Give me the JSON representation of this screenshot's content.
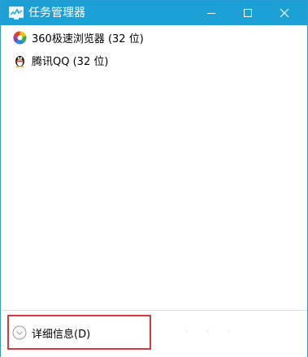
{
  "window": {
    "title": "任务管理器",
    "accent_color": "#1ba1d6",
    "icons": [
      "task-manager-icon",
      "minimize-icon",
      "maximize-icon",
      "close-icon"
    ]
  },
  "processes": [
    {
      "name": "360极速浏览器 (32 位)",
      "icon": "360-browser-icon"
    },
    {
      "name": "腾讯QQ (32 位)",
      "icon": "qq-penguin-icon"
    }
  ],
  "footer": {
    "details_label": "详细信息(D)",
    "highlight_color": "#d9363e"
  }
}
